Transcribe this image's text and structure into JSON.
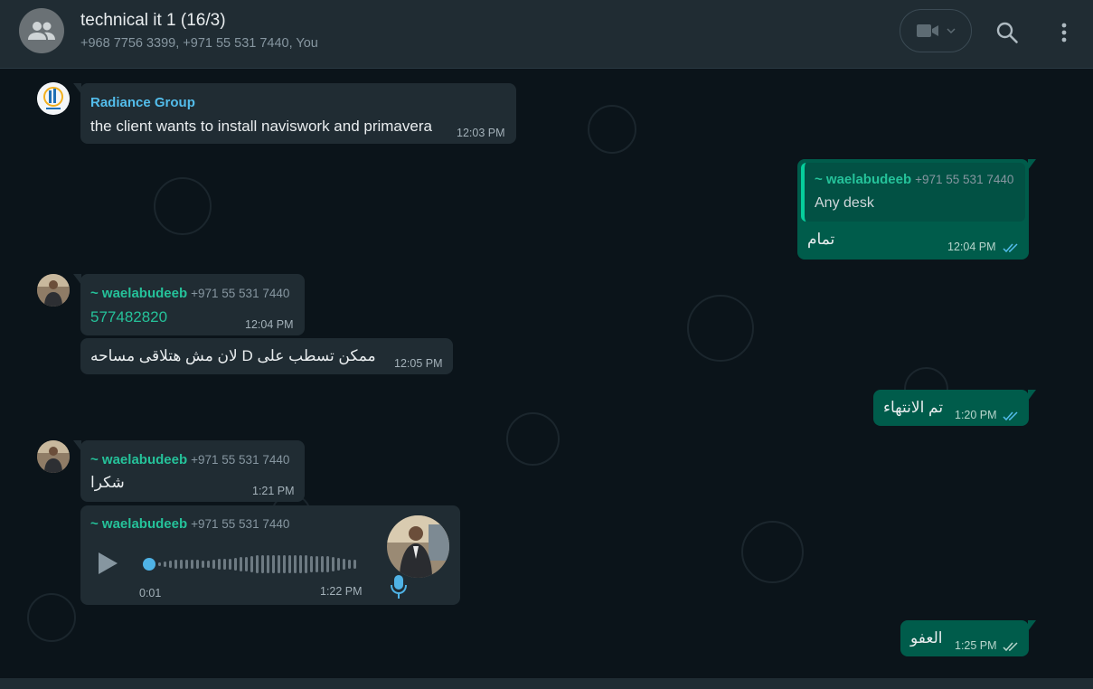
{
  "header": {
    "title": "technical it 1 (16/3)",
    "participants": "+968 7756 3399, +971 55 531 7440, You",
    "avatar_icon": "group-icon",
    "video_icon": "video-camera-icon",
    "search_icon": "search-icon",
    "menu_icon": "kebab-menu-icon"
  },
  "messages": {
    "m1": {
      "sender": "Radiance Group",
      "text": "the client wants to install naviswork and primavera",
      "time": "12:03 PM"
    },
    "m2": {
      "quote_sender": "~ waelabudeeb",
      "quote_phone": "+971 55 531 7440",
      "quote_text": "Any desk",
      "text": "تمام",
      "time": "12:04 PM"
    },
    "m3": {
      "sender": "~ waelabudeeb",
      "phone": "+971 55 531 7440",
      "text": "577482820",
      "time": "12:04 PM"
    },
    "m4": {
      "text": "ممكن تسطب على D لان مش هتلاقى مساحه",
      "time": "12:05 PM"
    },
    "m5": {
      "text": "تم الانتهاء",
      "time": "1:20 PM"
    },
    "m6": {
      "sender": "~ waelabudeeb",
      "phone": "+971 55 531 7440",
      "text": "شكرا",
      "time": "1:21 PM"
    },
    "m7": {
      "sender": "~ waelabudeeb",
      "phone": "+971 55 531 7440",
      "duration": "0:01",
      "time": "1:22 PM",
      "progress": 0
    },
    "m8": {
      "text": "العفو",
      "time": "1:25 PM"
    }
  },
  "colors": {
    "accent_green": "#25c29a",
    "outgoing_bubble": "#005c4b",
    "incoming_bubble": "#202c33",
    "read_ticks": "#53bdeb"
  }
}
